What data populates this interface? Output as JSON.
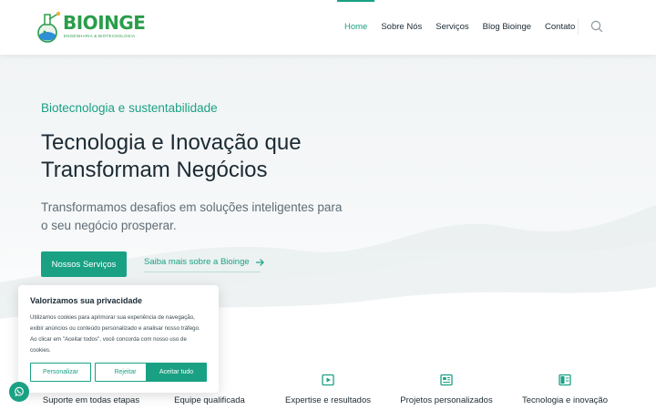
{
  "brand": {
    "name": "BIOINGE",
    "tagline": "ENGENHARIA & BIOTECNOLOGIA",
    "accent": "#1aa184",
    "logo_green": "#2a9d4a"
  },
  "nav": {
    "items": [
      {
        "label": "Home",
        "active": true
      },
      {
        "label": "Sobre Nós"
      },
      {
        "label": "Serviços"
      },
      {
        "label": "Blog Bioinge"
      },
      {
        "label": "Contato"
      }
    ],
    "search_icon": "search-icon"
  },
  "hero": {
    "eyebrow": "Biotecnologia e sustentabilidade",
    "headline": "Tecnologia e Inovação que Transformam Negócios",
    "subtext": "Transformamos desafios em soluções inteligentes para o seu negócio prosperar.",
    "primary_button": "Nossos Serviços",
    "secondary_link": "Saiba mais sobre a Bioinge"
  },
  "features": [
    {
      "label": "Suporte em todas etapas",
      "icon": "support-icon"
    },
    {
      "label": "Equipe qualificada",
      "icon": "team-icon"
    },
    {
      "label": "Expertise e resultados",
      "icon": "play-icon"
    },
    {
      "label": "Projetos personalizados",
      "icon": "newspaper-icon"
    },
    {
      "label": "Tecnologia e inovação",
      "icon": "layout-icon"
    }
  ],
  "cookie": {
    "title": "Valorizamos sua privacidade",
    "text": "Utilizamos cookies para aprimorar sua experiência de navegação, exibir anúncios ou conteúdo personalizado e analisar nosso tráfego. Ao clicar em \"Aceitar todos\", você concorda com nosso uso de cookies.",
    "customize": "Personalizar",
    "reject": "Rejeitar",
    "accept": "Aceitar tudo"
  },
  "whatsapp_icon": "whatsapp-icon"
}
